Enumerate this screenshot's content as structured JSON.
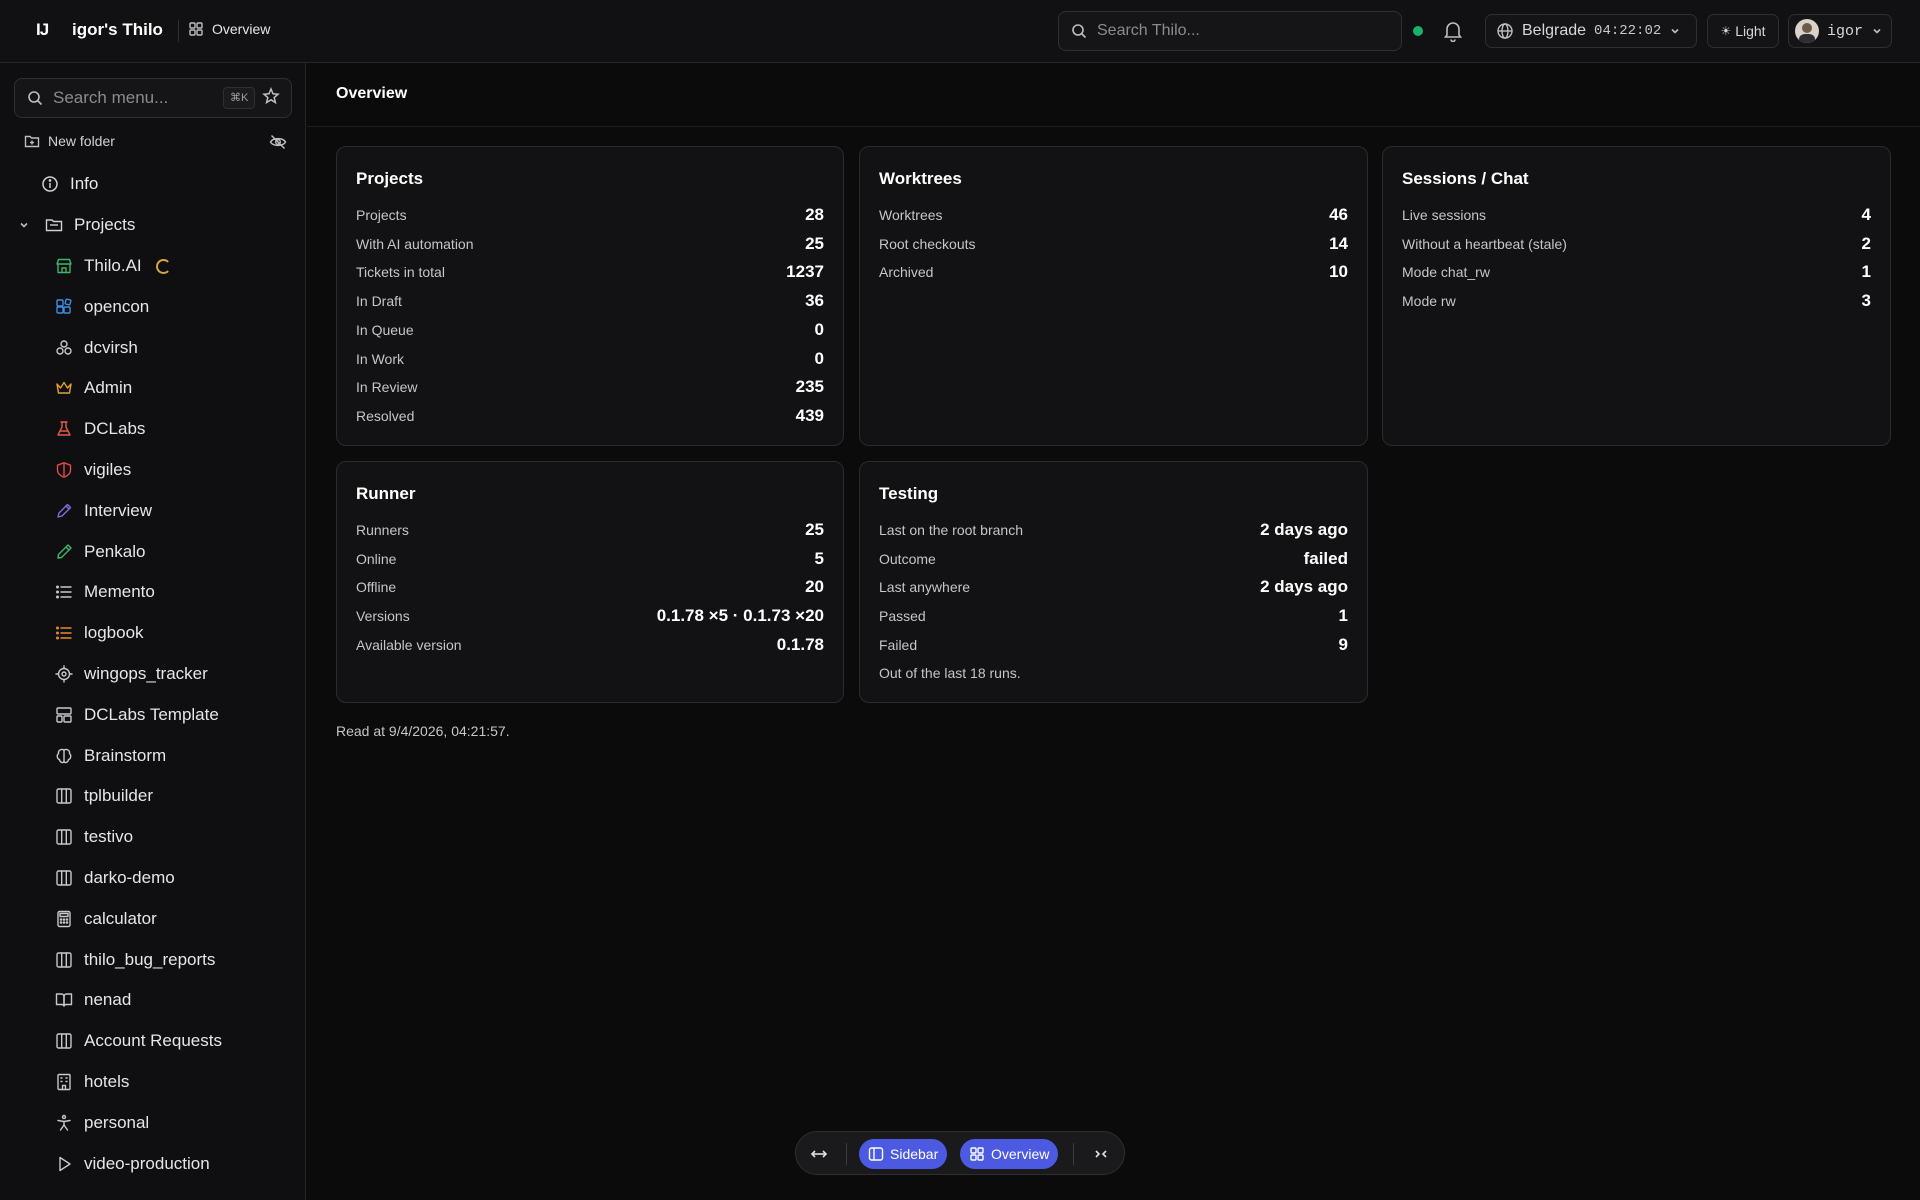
{
  "topbar": {
    "logo": "IJ",
    "workspace": "igor's Thilo",
    "breadcrumb": "Overview",
    "search_placeholder": "Search Thilo...",
    "timezone": "Belgrade",
    "time": "04:22:02",
    "theme": "Light",
    "user": "igor",
    "status_color": "#18b26b"
  },
  "sidebar": {
    "search_placeholder": "Search menu...",
    "shortcut": "⌘K",
    "new_folder": "New folder",
    "info": "Info",
    "projects_label": "Projects",
    "projects": [
      {
        "label": "Thilo.AI",
        "icon": "store-icon",
        "color": "#3fb56b"
      },
      {
        "label": "opencon",
        "icon": "blocks-icon",
        "color": "#3b8fe0"
      },
      {
        "label": "dcvirsh",
        "icon": "boxes-icon",
        "color": "#c8c8cc"
      },
      {
        "label": "Admin",
        "icon": "crown-icon",
        "color": "#e0a030"
      },
      {
        "label": "DCLabs",
        "icon": "flask-icon",
        "color": "#e05a4a"
      },
      {
        "label": "vigiles",
        "icon": "shield-icon",
        "color": "#e04a4a"
      },
      {
        "label": "Interview",
        "icon": "pen-icon",
        "color": "#8a6ae0"
      },
      {
        "label": "Penkalo",
        "icon": "pencil-icon",
        "color": "#3fb56b"
      },
      {
        "label": "Memento",
        "icon": "list-icon",
        "color": "#c8c8cc"
      },
      {
        "label": "logbook",
        "icon": "list-icon",
        "color": "#e08a30"
      },
      {
        "label": "wingops_tracker",
        "icon": "target-icon",
        "color": "#c8c8cc"
      },
      {
        "label": "DCLabs Template",
        "icon": "layout-icon",
        "color": "#c8c8cc"
      },
      {
        "label": "Brainstorm",
        "icon": "brain-icon",
        "color": "#c8c8cc"
      },
      {
        "label": "tplbuilder",
        "icon": "columns-icon",
        "color": "#c8c8cc"
      },
      {
        "label": "testivo",
        "icon": "columns-icon",
        "color": "#c8c8cc"
      },
      {
        "label": "darko-demo",
        "icon": "columns-icon",
        "color": "#c8c8cc"
      },
      {
        "label": "calculator",
        "icon": "calculator-icon",
        "color": "#c8c8cc"
      },
      {
        "label": "thilo_bug_reports",
        "icon": "columns-icon",
        "color": "#c8c8cc"
      },
      {
        "label": "nenad",
        "icon": "book-icon",
        "color": "#c8c8cc"
      },
      {
        "label": "Account Requests",
        "icon": "columns-icon",
        "color": "#c8c8cc"
      },
      {
        "label": "hotels",
        "icon": "building-icon",
        "color": "#c8c8cc"
      },
      {
        "label": "personal",
        "icon": "person-icon",
        "color": "#c8c8cc"
      },
      {
        "label": "video-production",
        "icon": "play-icon",
        "color": "#c8c8cc"
      }
    ]
  },
  "main": {
    "title": "Overview",
    "read_at": "Read at 9/4/2026, 04:21:57.",
    "cards": {
      "projects": {
        "title": "Projects",
        "rows": [
          {
            "label": "Projects",
            "value": "28"
          },
          {
            "label": "With AI automation",
            "value": "25"
          },
          {
            "label": "Tickets in total",
            "value": "1237"
          },
          {
            "label": "In Draft",
            "value": "36"
          },
          {
            "label": "In Queue",
            "value": "0"
          },
          {
            "label": "In Work",
            "value": "0"
          },
          {
            "label": "In Review",
            "value": "235"
          },
          {
            "label": "Resolved",
            "value": "439"
          }
        ]
      },
      "worktrees": {
        "title": "Worktrees",
        "rows": [
          {
            "label": "Worktrees",
            "value": "46"
          },
          {
            "label": "Root checkouts",
            "value": "14"
          },
          {
            "label": "Archived",
            "value": "10"
          }
        ]
      },
      "sessions": {
        "title": "Sessions / Chat",
        "rows": [
          {
            "label": "Live sessions",
            "value": "4"
          },
          {
            "label": "Without a heartbeat (stale)",
            "value": "2"
          },
          {
            "label": "Mode chat_rw",
            "value": "1"
          },
          {
            "label": "Mode rw",
            "value": "3"
          }
        ]
      },
      "runner": {
        "title": "Runner",
        "rows": [
          {
            "label": "Runners",
            "value": "25"
          },
          {
            "label": "Online",
            "value": "5"
          },
          {
            "label": "Offline",
            "value": "20"
          },
          {
            "label": "Versions",
            "value": "0.1.78 ×5 · 0.1.73 ×20"
          },
          {
            "label": "Available version",
            "value": "0.1.78"
          }
        ]
      },
      "testing": {
        "title": "Testing",
        "rows": [
          {
            "label": "Last on the root branch",
            "value": "2 days ago"
          },
          {
            "label": "Outcome",
            "value": "failed"
          },
          {
            "label": "Last anywhere",
            "value": "2 days ago"
          },
          {
            "label": "Passed",
            "value": "1"
          },
          {
            "label": "Failed",
            "value": "9"
          }
        ],
        "note": "Out of the last 18 runs."
      }
    }
  },
  "floatbar": {
    "sidebar_label": "Sidebar",
    "overview_label": "Overview",
    "accent": "#4b5ae0"
  }
}
